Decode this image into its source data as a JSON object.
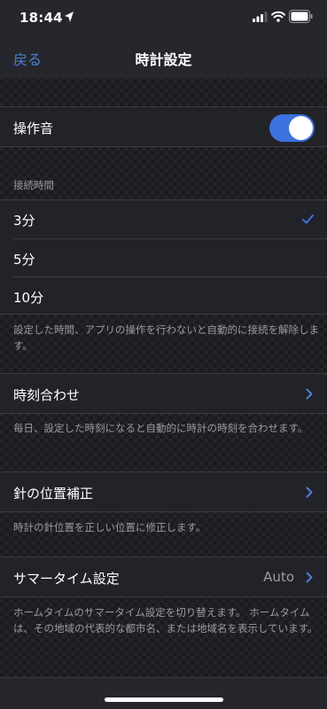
{
  "status_bar": {
    "time": "18:44"
  },
  "nav": {
    "back_label": "戻る",
    "title": "時計設定"
  },
  "sound": {
    "label": "操作音",
    "enabled": true
  },
  "connection": {
    "header": "接続時間",
    "options": [
      {
        "label": "3分",
        "selected": true
      },
      {
        "label": "5分",
        "selected": false
      },
      {
        "label": "10分",
        "selected": false
      }
    ],
    "footnote": "設定した時間、アプリの操作を行わないと自動的に接続を解除します。"
  },
  "time_sync": {
    "label": "時刻合わせ",
    "footnote": "毎日、設定した時刻になると自動的に時計の時刻を合わせます。"
  },
  "hand_position": {
    "label": "針の位置補正",
    "footnote": "時計の針位置を正しい位置に修正します。"
  },
  "summer_time": {
    "label": "サマータイム設定",
    "value": "Auto",
    "footnote": "ホームタイムのサマータイム設定を切り替えます。 ホームタイムは、その地域の代表的な都市名、または地域名を表示しています。"
  },
  "colors": {
    "accent": "#3e71e0",
    "link": "#4d7fd8",
    "cell_bg": "#222429",
    "secondary_text": "#9a9ca2"
  }
}
